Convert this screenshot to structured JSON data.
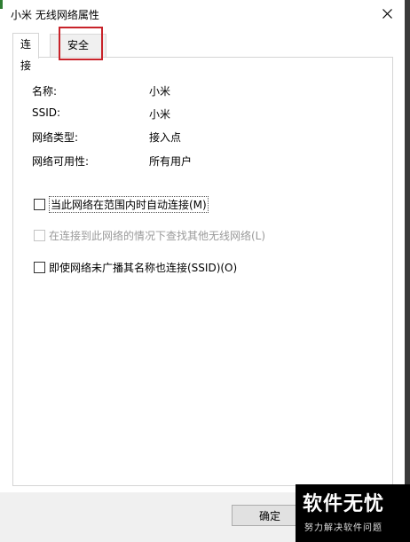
{
  "window": {
    "title": "小米 无线网络属性"
  },
  "tabs": [
    {
      "label": "连接"
    },
    {
      "label": "安全"
    }
  ],
  "info": [
    {
      "label": "名称:",
      "value": "小米"
    },
    {
      "label": "SSID:",
      "value": "小米"
    },
    {
      "label": "网络类型:",
      "value": "接入点"
    },
    {
      "label": "网络可用性:",
      "value": "所有用户"
    }
  ],
  "options": {
    "auto_connect": {
      "text": "当此网络在范围内时自动连接(M)",
      "checked": false,
      "enabled": true
    },
    "find_other": {
      "text": "在连接到此网络的情况下查找其他无线网络(L)",
      "checked": false,
      "enabled": false
    },
    "hidden_ssid": {
      "text": "即使网络未广播其名称也连接(SSID)(O)",
      "checked": false,
      "enabled": true
    }
  },
  "buttons": {
    "ok": "确定"
  },
  "watermark": {
    "main": "软件无忧",
    "sub": "努力解决软件问题"
  },
  "colors": {
    "highlight": "#c8232a",
    "watermark_gold": "#e9b62c"
  }
}
